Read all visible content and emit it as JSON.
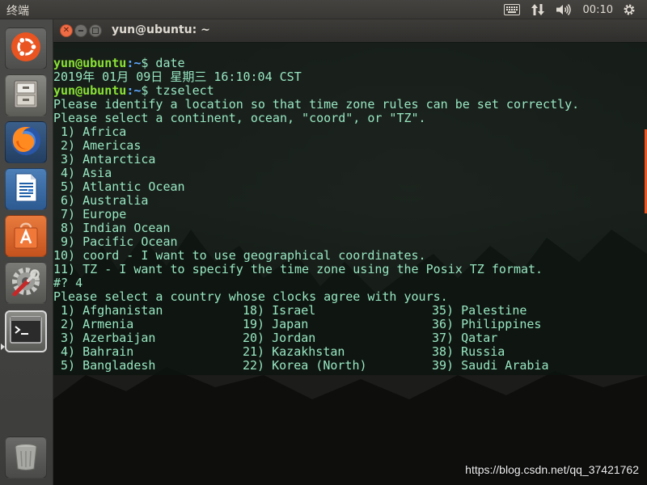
{
  "top_panel": {
    "title": "终端",
    "clock": "00:10",
    "icons": [
      "keyboard-icon",
      "network-arrows-icon",
      "volume-icon",
      "gear-icon"
    ]
  },
  "launcher": {
    "items": [
      {
        "name": "ubuntu-dash",
        "icon": "ubuntu-logo-icon"
      },
      {
        "name": "files",
        "icon": "file-cabinet-icon"
      },
      {
        "name": "firefox",
        "icon": "firefox-icon"
      },
      {
        "name": "libreoffice-writer",
        "icon": "document-icon"
      },
      {
        "name": "software-center",
        "icon": "shopping-bag-icon"
      },
      {
        "name": "system-settings",
        "icon": "settings-wrench-icon"
      },
      {
        "name": "terminal",
        "icon": "terminal-icon"
      },
      {
        "name": "trash",
        "icon": "trash-icon"
      }
    ]
  },
  "window": {
    "title": "yun@ubuntu: ~"
  },
  "terminal": {
    "prompt_user": "yun@ubuntu",
    "prompt_path": ":~",
    "prompt_symbol": "$",
    "cmd1": " date",
    "date_output": "2019年 01月 09日 星期三 16:10:04 CST",
    "cmd2": " tzselect",
    "identify": "Please identify a location so that time zone rules can be set correctly.",
    "select_continent": "Please select a continent, ocean, \"coord\", or \"TZ\".",
    "continents": [
      " 1) Africa",
      " 2) Americas",
      " 3) Antarctica",
      " 4) Asia",
      " 5) Atlantic Ocean",
      " 6) Australia",
      " 7) Europe",
      " 8) Indian Ocean",
      " 9) Pacific Ocean",
      "10) coord - I want to use geographical coordinates.",
      "11) TZ - I want to specify the time zone using the Posix TZ format."
    ],
    "answer": "#? 4",
    "select_country": "Please select a country whose clocks agree with yours.",
    "countries": [
      [
        " 1) Afghanistan",
        "18) Israel",
        "35) Palestine"
      ],
      [
        " 2) Armenia",
        "19) Japan",
        "36) Philippines"
      ],
      [
        " 3) Azerbaijan",
        "20) Jordan",
        "37) Qatar"
      ],
      [
        " 4) Bahrain",
        "21) Kazakhstan",
        "38) Russia"
      ],
      [
        " 5) Bangladesh",
        "22) Korea (North)",
        "39) Saudi Arabia"
      ]
    ]
  },
  "watermark": "https://blog.csdn.net/qq_37421762",
  "colors": {
    "terminal_text": "#98e7c2",
    "prompt_user": "#8ae234",
    "prompt_path": "#5ea8ff",
    "accent": "#e95420"
  }
}
